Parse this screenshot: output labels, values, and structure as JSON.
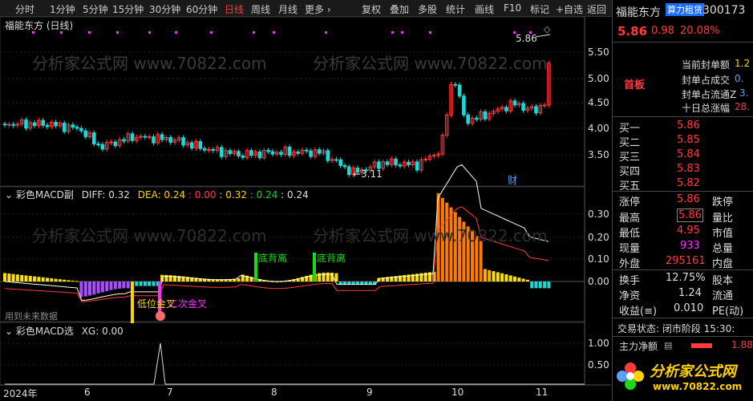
{
  "toolbar": {
    "periods": [
      "分时",
      "1分钟",
      "5分钟",
      "15分钟",
      "30分钟",
      "60分钟",
      "日线",
      "周线",
      "月线",
      "更多 ›"
    ],
    "active_period": "日线",
    "tools": [
      "复权",
      "叠加",
      "多股",
      "统计",
      "画线",
      "F10",
      "标记",
      "+自选",
      "返回"
    ]
  },
  "main_pane": {
    "title": "福能东方 (日线)",
    "price_labels": [
      "5.50",
      "5.00",
      "4.50",
      "4.00",
      "3.50"
    ],
    "high_marker": "5.86",
    "low_marker": "←3.11",
    "cai_badge": "财"
  },
  "macd_pane": {
    "name": "彩色MACD副",
    "diff_label": "DIFF: 0.32",
    "dea_label": "DEA: 0.24",
    "v1": ": 0.00",
    "v2": ": 0.32",
    "v3": ": 0.24",
    "v4": ": 0.24",
    "axis": [
      "0.30",
      "0.20",
      "0.10",
      "0.00"
    ],
    "annotations": [
      "底背离",
      "底背离",
      "低位金叉",
      "二次金叉"
    ],
    "future_note": "用到未来数据"
  },
  "xg_pane": {
    "name": "彩色MACD选",
    "xg_label": "XG: 0.00",
    "axis": [
      "1.00",
      "0.50"
    ]
  },
  "x_axis": [
    "2024年",
    "6",
    "7",
    "8",
    "9",
    "10",
    "11"
  ],
  "sidebar": {
    "stock_name": "福能东方",
    "tag": "算力租赁",
    "code": "300173",
    "price": "5.86",
    "change": "0.98",
    "change_pct": "20.08%",
    "limit_label": "首板",
    "stats": [
      {
        "label": "当前封单额",
        "value": "1.2"
      },
      {
        "label": "封单占成交",
        "value": "0."
      },
      {
        "label": "封单占流通Z",
        "value": "3."
      },
      {
        "label": "十日总涨幅",
        "value": "28."
      }
    ],
    "bids": [
      {
        "label": "买一",
        "value": "5.86"
      },
      {
        "label": "买二",
        "value": "5.85"
      },
      {
        "label": "买三",
        "value": "5.84"
      },
      {
        "label": "买四",
        "value": "5.83"
      },
      {
        "label": "买五",
        "value": "5.82"
      }
    ],
    "quote": [
      {
        "l1": "涨停",
        "v1": "5.86",
        "l2": "跌停"
      },
      {
        "l1": "最高",
        "v1": "5.86",
        "l2": "量比"
      },
      {
        "l1": "最低",
        "v1": "4.95",
        "l2": "市值"
      },
      {
        "l1": "现量",
        "v1": "933",
        "l2": "总量"
      },
      {
        "l1": "外盘",
        "v1": "295161",
        "l2": "内盘"
      }
    ],
    "quote2": [
      {
        "l1": "换手",
        "v1": "12.75%",
        "l2": "股本"
      },
      {
        "l1": "净资",
        "v1": "1.24",
        "l2": "流通"
      },
      {
        "l1": "收益(≡)",
        "v1": "0.010",
        "l2": "PE(动)"
      }
    ],
    "trade_status": "交易状态: 闭市阶段 15:30:",
    "main_flow_label": "主力净额",
    "main_flow_value": "1.88",
    "logo_text": "分析家公式网",
    "logo_url": "www.70822.com"
  },
  "watermark": "分析家公式网 www.70822.com",
  "colors": {
    "up": "#ff3b3b",
    "down": "#19d9d9",
    "accent": "#ffd200",
    "purple": "#ff2dff"
  }
}
